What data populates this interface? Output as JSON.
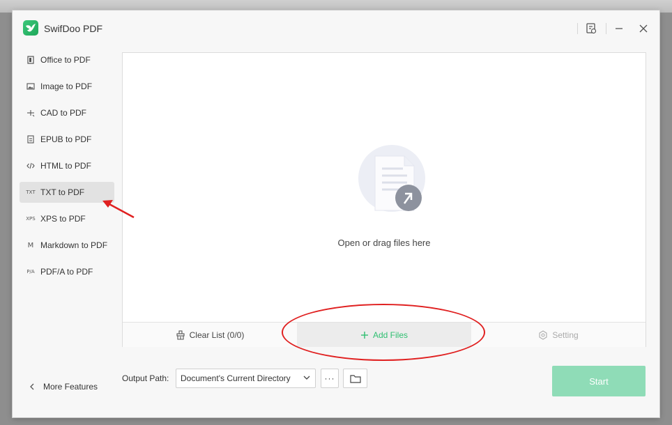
{
  "app": {
    "title": "SwifDoo PDF"
  },
  "sidebar": {
    "items": [
      {
        "label": "Office to PDF",
        "icon": "office-icon",
        "active": false
      },
      {
        "label": "Image to PDF",
        "icon": "image-icon",
        "active": false
      },
      {
        "label": "CAD to PDF",
        "icon": "cad-icon",
        "active": false
      },
      {
        "label": "EPUB to PDF",
        "icon": "epub-icon",
        "active": false
      },
      {
        "label": "HTML to PDF",
        "icon": "html-icon",
        "active": false
      },
      {
        "label": "TXT to PDF",
        "icon": "txt-icon",
        "active": true
      },
      {
        "label": "XPS to PDF",
        "icon": "xps-icon",
        "active": false
      },
      {
        "label": "Markdown to PDF",
        "icon": "markdown-icon",
        "active": false
      },
      {
        "label": "PDF/A to PDF",
        "icon": "pdfa-icon",
        "active": false
      }
    ],
    "icon_text": {
      "txt": "TXT",
      "xps": "XPS",
      "markdown": "M",
      "pdfa": "P/A"
    },
    "more_features": "More Features"
  },
  "drop_area": {
    "hint": "Open or drag files here",
    "clear_list": "Clear List (0/0)",
    "add_files": "Add Files",
    "setting": "Setting"
  },
  "output": {
    "label": "Output Path:",
    "value": "Document's Current Directory",
    "more_label": "···"
  },
  "actions": {
    "start": "Start"
  },
  "colors": {
    "accent": "#2fbf71",
    "start_disabled": "#8fdcb7",
    "annotation": "#e02020",
    "active_item_bg": "#e2e2e2"
  }
}
